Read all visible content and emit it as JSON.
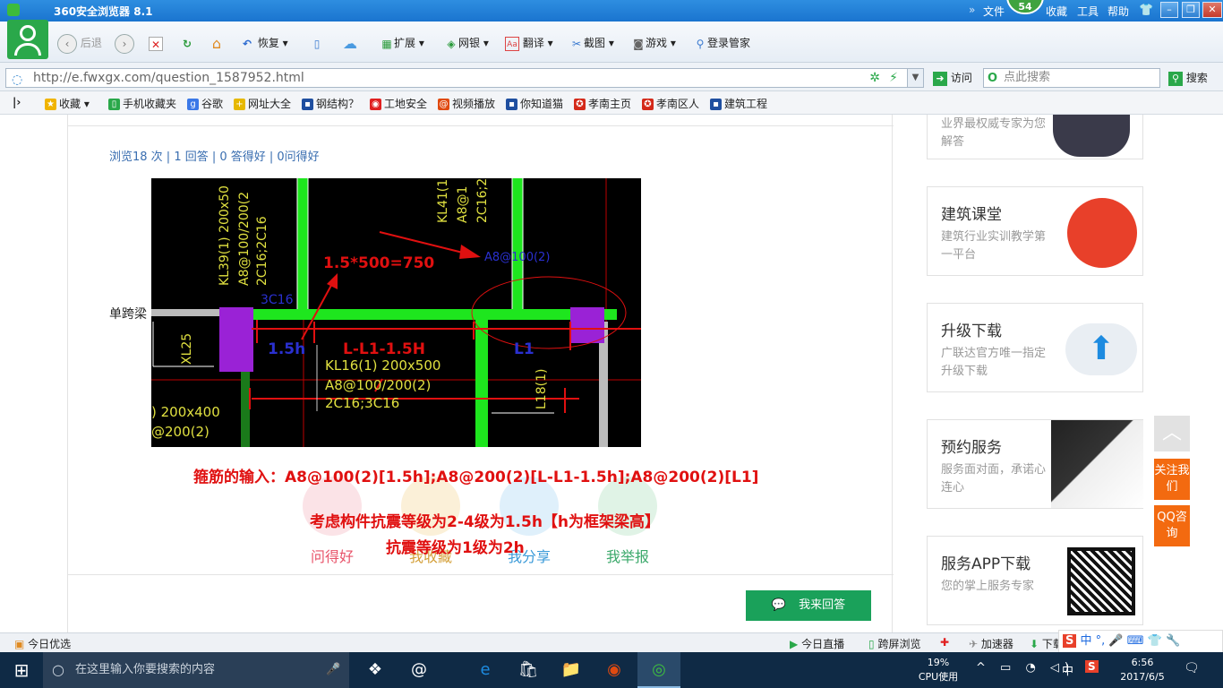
{
  "window": {
    "title": "360安全浏览器 8.1",
    "menu": [
      "文件",
      "收藏",
      "工具",
      "帮助"
    ],
    "badge": "54"
  },
  "toolbar": {
    "back": "后退",
    "restore": "恢复",
    "extend": "扩展",
    "bank": "网银",
    "translate": "翻译",
    "screenshot": "截图",
    "games": "游戏",
    "login": "登录管家"
  },
  "address": {
    "url": "http://e.fwxgx.com/question_1587952.html",
    "visit": "访问",
    "search_placeholder": "点此搜索",
    "search_btn": "搜索"
  },
  "bookmarks": [
    {
      "label": "收藏",
      "icon": "star-icon",
      "color": "#f0b400"
    },
    {
      "label": "手机收藏夹",
      "icon": "phone-icon",
      "color": "#2aa84a"
    },
    {
      "label": "谷歌",
      "icon": "google-icon",
      "color": "#3b78e7"
    },
    {
      "label": "网址大全",
      "icon": "plus-icon",
      "color": "#e6b800"
    },
    {
      "label": "钢结构？",
      "icon": "site-icon",
      "color": "#1f4fa0"
    },
    {
      "label": "工地安全",
      "icon": "baidu-icon",
      "color": "#e02020"
    },
    {
      "label": "视频播放",
      "icon": "swirl-icon",
      "color": "#e04a10"
    },
    {
      "label": "你知道猫",
      "icon": "site-icon",
      "color": "#1f4fa0"
    },
    {
      "label": "孝南主页",
      "icon": "emblem-icon",
      "color": "#d42a1a"
    },
    {
      "label": "孝南区人",
      "icon": "emblem-icon",
      "color": "#d42a1a"
    },
    {
      "label": "建筑工程",
      "icon": "site-icon",
      "color": "#1f4fa0"
    }
  ],
  "question": {
    "stats": "浏览18 次 | 1 回答 | 0 答得好 | 0问得好",
    "beam_label": "单跨梁",
    "cad": {
      "t1": "KL39(1) 200x50",
      "t2": "A8@100/200(2",
      "t3": "2C16;2C16",
      "t4": "KL41(1",
      "t5": "A8@1",
      "t6": "2C16;2",
      "t7": "A8@100(2)",
      "t8": "1.5*500=750",
      "t9": "3C16",
      "t10": "1.5h",
      "t11": "L-L1-1.5H",
      "t12": "L1",
      "t13": "XL25",
      "t14": "KL16(1) 200x500",
      "t15": "A8@100/200(2)",
      "t16": "2C16;3C16",
      "t17": "L18(1)",
      "t18": ") 200x400",
      "t19": "@200(2)"
    },
    "note1": "箍筋的输入：A8@100(2)[1.5h];A8@200(2)[L-L1-1.5h];A8@200(2)[L1]",
    "note2": "考虑构件抗震等级为2-4级为1.5h【h为框架梁高】",
    "note3": "抗震等级为1级为2h",
    "actions": [
      {
        "label": "问得好",
        "color": "#e8536a",
        "bg": "#fbe3e7"
      },
      {
        "label": "我收藏",
        "color": "#d4a03a",
        "bg": "#fbf0d8"
      },
      {
        "label": "我分享",
        "color": "#3a9ad8",
        "bg": "#dff0fb"
      },
      {
        "label": "我举报",
        "color": "#3aa86a",
        "bg": "#e0f3e6"
      }
    ],
    "reply": "我来回答"
  },
  "sidebar": [
    {
      "title": "",
      "sub": "业界最权威专家为您解答"
    },
    {
      "title": "建筑课堂",
      "sub": "建筑行业实训教学第一平台"
    },
    {
      "title": "升级下载",
      "sub": "广联达官方唯一指定升级下载"
    },
    {
      "title": "预约服务",
      "sub": "服务面对面，承诺心连心"
    },
    {
      "title": "服务APP下载",
      "sub": "您的掌上服务专家"
    }
  ],
  "float": {
    "follow": "关注我们",
    "qq": "QQ咨询"
  },
  "status": {
    "today": "今日优选",
    "live": "今日直播",
    "cross": "跨屏浏览",
    "accel": "加速器",
    "down": "下载"
  },
  "taskbar": {
    "search": "在这里输入你要搜索的内容",
    "cpu_pct": "19%",
    "cpu": "CPU使用",
    "ime": "中",
    "time": "6:56",
    "date": "2017/6/5"
  }
}
